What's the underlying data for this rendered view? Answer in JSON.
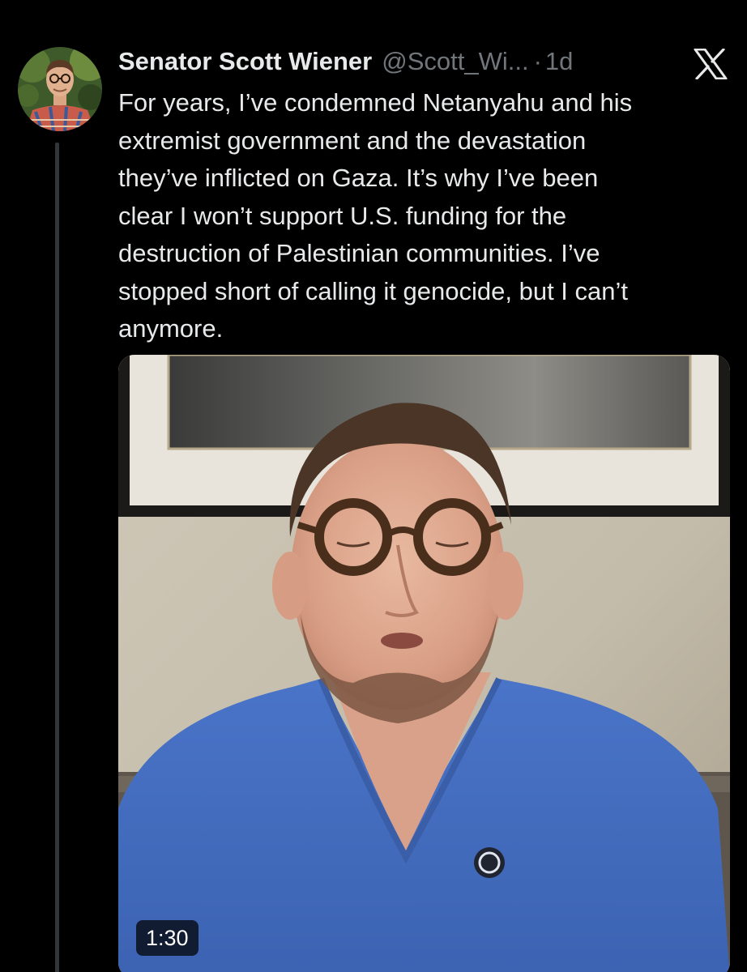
{
  "tweet": {
    "author": {
      "display_name": "Senator Scott Wiener",
      "handle": "@Scott_Wi...",
      "separator": "·",
      "timestamp": "1d"
    },
    "text_lines": [
      "For years, I’ve condemned Netanyahu and his",
      "extremist government and the devastation",
      "they’ve inflicted on Gaza. It’s why I’ve been",
      "clear I won’t support U.S. funding for the",
      "destruction of Palestinian communities. I’ve",
      "stopped short of calling it genocide, but I can’t",
      "anymore."
    ],
    "media": {
      "type": "video",
      "duration": "1:30"
    }
  },
  "icons": {
    "platform_logo": "x-logo-icon",
    "avatar": "avatar-photo"
  },
  "colors": {
    "background": "#000000",
    "primary_text": "#e7e9ea",
    "secondary_text": "#71767b",
    "thread_line": "#333639"
  }
}
